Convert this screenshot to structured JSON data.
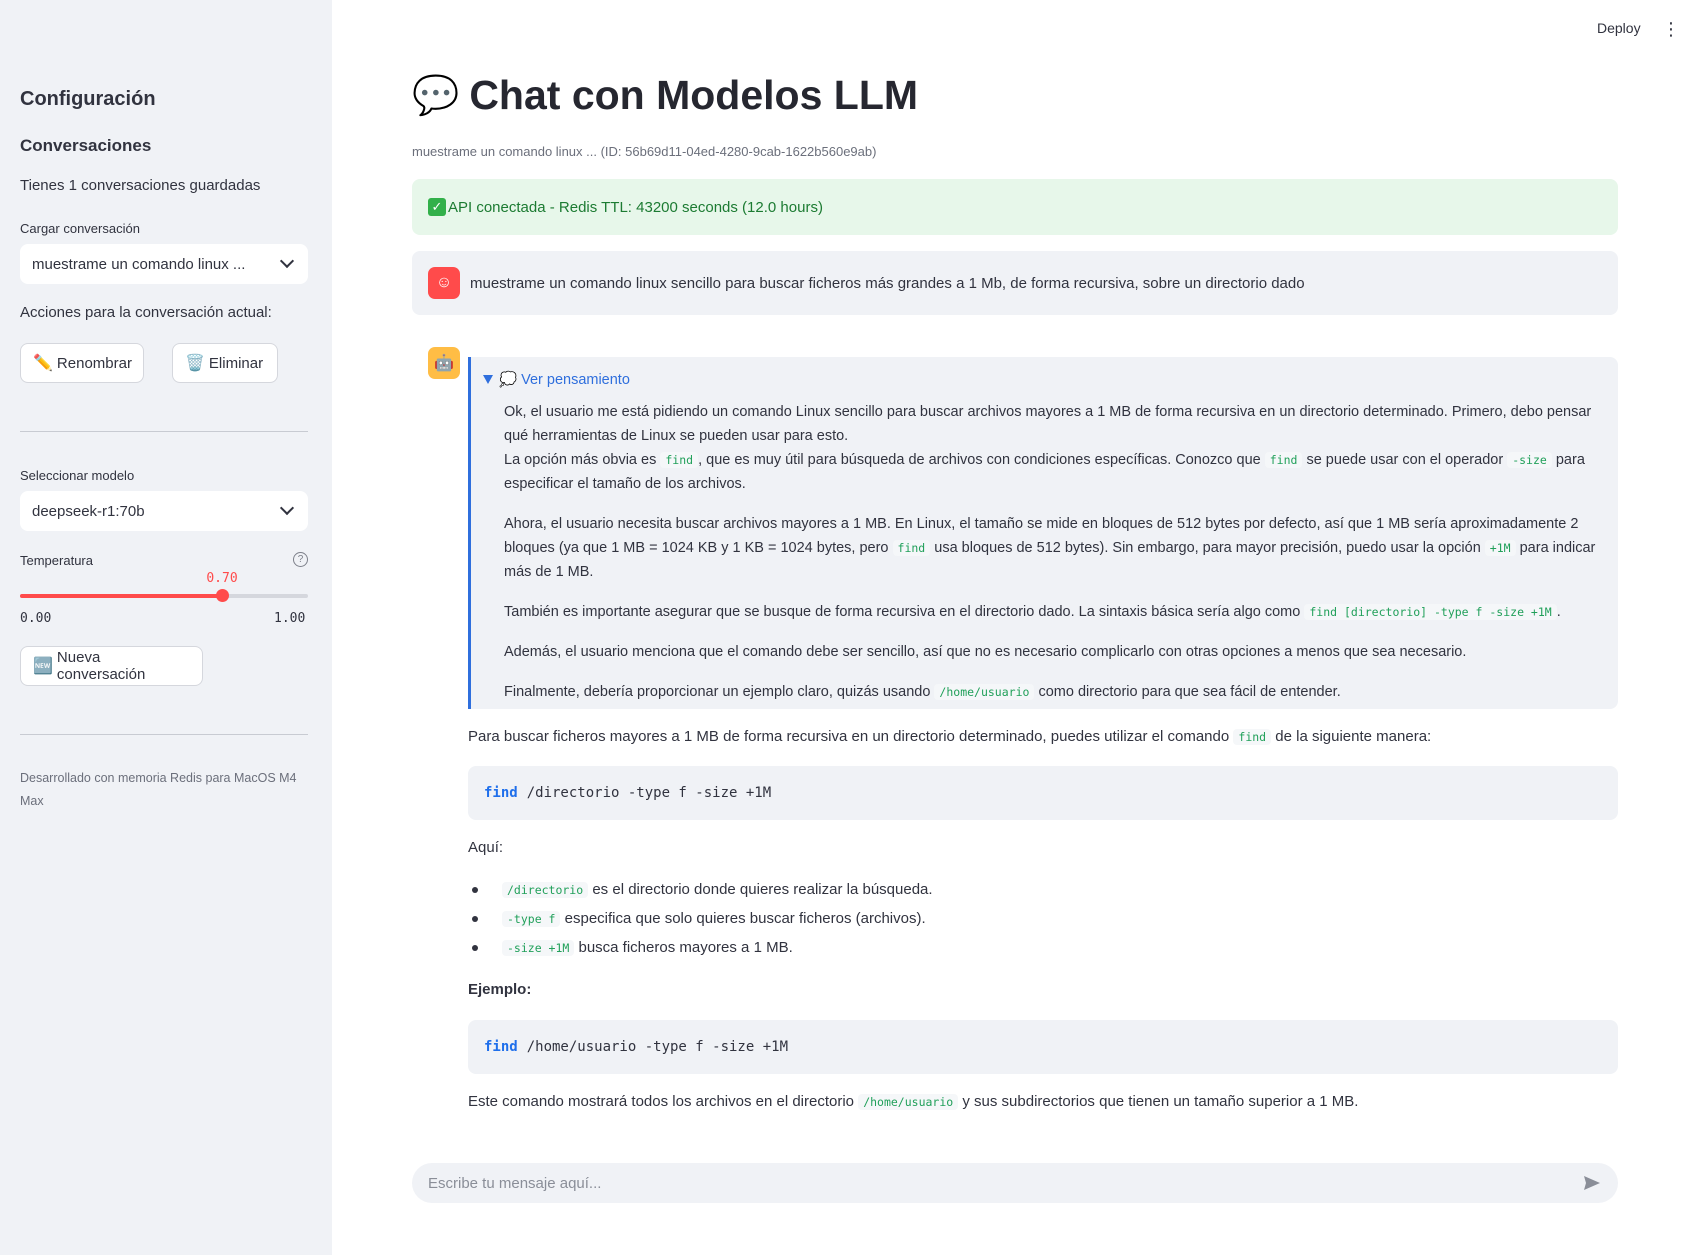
{
  "sidebar": {
    "config_title": "Configuración",
    "conversations_title": "Conversaciones",
    "saved_count": "Tienes 1 conversaciones guardadas",
    "load_label": "Cargar conversación",
    "load_value": "muestrame un comando linux ...",
    "actions_label": "Acciones para la conversación actual:",
    "rename_icon": "pencil-icon",
    "rename_label": "Renombrar",
    "delete_icon": "trash-icon",
    "delete_label": "Eliminar",
    "model_label": "Seleccionar modelo",
    "model_value": "deepseek-r1:70b",
    "temp_label": "Temperatura",
    "temp_value": "0.70",
    "temp_fraction": 0.7,
    "temp_min": "0.00",
    "temp_max": "1.00",
    "new_icon": "new-badge-icon",
    "new_label": "Nueva conversación",
    "footer": "Desarrollado con memoria Redis para MacOS M4 Max"
  },
  "header": {
    "deploy": "Deploy",
    "menu_icon": "⋮"
  },
  "main": {
    "title_icon": "💬",
    "title": "Chat con Modelos LLM",
    "caption": "muestrame un comando linux ... (ID: 56b69d11-04ed-4280-9cab-1622b560e9ab)",
    "alert": "API conectada - Redis TTL: 43200 seconds (12.0 hours)",
    "alert_color": "#e7f7ea",
    "user_message": "muestrame un comando linux sencillo para buscar ficheros más grandes a 1 Mb, de forma recursiva, sobre un directorio dado",
    "think": {
      "summary": "💭 Ver pensamiento",
      "p1a": "Ok, el usuario me está pidiendo un comando Linux sencillo para buscar archivos mayores a 1 MB de forma recursiva en un directorio determinado. Primero, debo pensar qué herramientas de Linux se pueden usar para esto.",
      "p1b_1": "La opción más obvia es",
      "p1b_c1": "find",
      "p1b_2": ", que es muy útil para búsqueda de archivos con condiciones específicas. Conozco que",
      "p1b_c2": "find",
      "p1b_3": "se puede usar con el operador",
      "p1b_c3": "-size",
      "p1b_4": "para especificar el tamaño de los archivos.",
      "p2_1": "Ahora, el usuario necesita buscar archivos mayores a 1 MB. En Linux, el tamaño se mide en bloques de 512 bytes por defecto, así que 1 MB sería aproximadamente 2 bloques (ya que 1 MB = 1024 KB y 1 KB = 1024 bytes, pero",
      "p2_c1": "find",
      "p2_2": "usa bloques de 512 bytes). Sin embargo, para mayor precisión, puedo usar la opción",
      "p2_c2": "+1M",
      "p2_3": "para indicar más de 1 MB.",
      "p3_1": "También es importante asegurar que se busque de forma recursiva en el directorio dado. La sintaxis básica sería algo como",
      "p3_c1": "find [directorio] -type f -size +1M",
      "p3_2": ".",
      "p4": "Además, el usuario menciona que el comando debe ser sencillo, así que no es necesario complicarlo con otras opciones a menos que sea necesario.",
      "p5_1": "Finalmente, debería proporcionar un ejemplo claro, quizás usando",
      "p5_c1": "/home/usuario",
      "p5_2": "como directorio para que sea fácil de entender."
    },
    "answer": {
      "intro_1": "Para buscar ficheros mayores a 1 MB de forma recursiva en un directorio determinado, puedes utilizar el comando",
      "intro_c": "find",
      "intro_2": "de la siguiente manera:",
      "code1_kw": "find",
      "code1_rest": "/directorio -type f -size +1M",
      "aqui": "Aquí:",
      "b1_c": "/directorio",
      "b1_t": "es el directorio donde quieres realizar la búsqueda.",
      "b2_c": "-type f",
      "b2_t": "especifica que solo quieres buscar ficheros (archivos).",
      "b3_c": "-size +1M",
      "b3_t": "busca ficheros mayores a 1 MB.",
      "ejemplo": "Ejemplo:",
      "code2_kw": "find",
      "code2_rest": "/home/usuario -type f -size +1M",
      "outro_1": "Este comando mostrará todos los archivos en el directorio",
      "outro_c": "/home/usuario",
      "outro_2": "y sus subdirectorios que tienen un tamaño superior a 1 MB."
    },
    "input_placeholder": "Escribe tu mensaje aquí..."
  }
}
